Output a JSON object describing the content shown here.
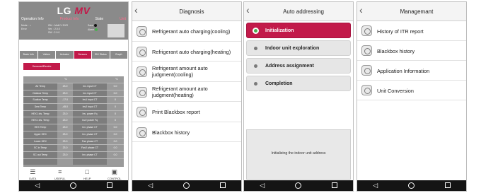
{
  "phone1": {
    "logo_lg": "LG",
    "logo_mv": "MV",
    "header": [
      "Operation Info",
      "Product Info",
      "State",
      "Unit"
    ],
    "info_rows": [
      {
        "text": "Mode  ·  ○"
      },
      {
        "text": "Error"
      },
      {
        "text": "IDU : Multi V  DXR"
      },
      {
        "text": "Ver. : 2.0.0"
      },
      {
        "text": "SW  : 2.0.0"
      },
      {
        "text": "Save"
      },
      {
        "text": "Alarm"
      }
    ],
    "tabs": [
      "Basic Info",
      "Valves",
      "Actuator",
      "Sensors",
      "IDU Status",
      "Graph"
    ],
    "active_tab_index": 3,
    "selected_label": "Sensors&Electric",
    "table_headers": [
      "",
      "°C",
      "",
      "°C"
    ],
    "rows": [
      [
        "Air Temp",
        "23.0",
        "Inv. input CT",
        "0.0"
      ],
      [
        "Outdoor Temp",
        "23.0",
        "Inv. input CT",
        "0.0"
      ],
      [
        "Suction Temp",
        "-17.0",
        "Inv1 input CT",
        "0"
      ],
      [
        "Dew Temp",
        "-45.0",
        "Inv2 input CT",
        "0"
      ],
      [
        "HEX1 dis. Temp",
        "23.0",
        "Inv. power Fq",
        "0"
      ],
      [
        "HEX1 dis. Temp",
        "23.0",
        "Inv2 power Fq",
        "0"
      ],
      [
        "HEX Temp",
        "23.0",
        "Inv. phase CT",
        "0.0"
      ],
      [
        "Upper HEX",
        "23.0",
        "Inv. phase CT",
        "0.0"
      ],
      [
        "Lower HEX",
        "23.0",
        "Fan phase CT",
        "0.0"
      ],
      [
        "SC in Temp",
        "23.0",
        "Fan2 phase CT",
        "0.0"
      ],
      [
        "SC out Temp",
        "23.0",
        "Inv. phase CT",
        "0.0"
      ],
      [
        "",
        "",
        "",
        ""
      ]
    ],
    "bottom_nav": [
      {
        "icon": "database-icon",
        "label": "DATA"
      },
      {
        "icon": "menu-icon",
        "label": "USEFUL"
      },
      {
        "icon": "help-icon",
        "label": "HELP"
      },
      {
        "icon": "control-icon",
        "label": "CONTROL"
      }
    ]
  },
  "phone2": {
    "title": "Diagnosis",
    "items": [
      {
        "label": "Refrigerant auto charging(cooling)",
        "lines": 1
      },
      {
        "label": "Refrigerant auto charging(heating)",
        "lines": 1
      },
      {
        "label": "Refrigerant amount auto judgment(cooling)",
        "lines": 2
      },
      {
        "label": "Refrigerant amount auto judgment(heating)",
        "lines": 2
      },
      {
        "label": "Print Blackbox report",
        "lines": 1
      },
      {
        "label": "Blackbox history",
        "lines": 1
      }
    ]
  },
  "phone3": {
    "title": "Auto addressing",
    "items": [
      {
        "label": "Initialization",
        "active": true
      },
      {
        "label": "Indoor unit exploration",
        "active": false
      },
      {
        "label": "Address assignment",
        "active": false
      },
      {
        "label": "Completion",
        "active": false
      }
    ],
    "status_message": "Initializing the indoor unit address"
  },
  "phone4": {
    "title": "Managemant",
    "items": [
      {
        "label": "History of ITR report"
      },
      {
        "label": "Blackbox history"
      },
      {
        "label": "Application Information"
      },
      {
        "label": "Unit Conversion"
      }
    ]
  },
  "colors": {
    "accent": "#c21a4a",
    "header_gray": "#8a8a8a",
    "nav_bar": "#141414",
    "active_dot": "#4caf50"
  }
}
